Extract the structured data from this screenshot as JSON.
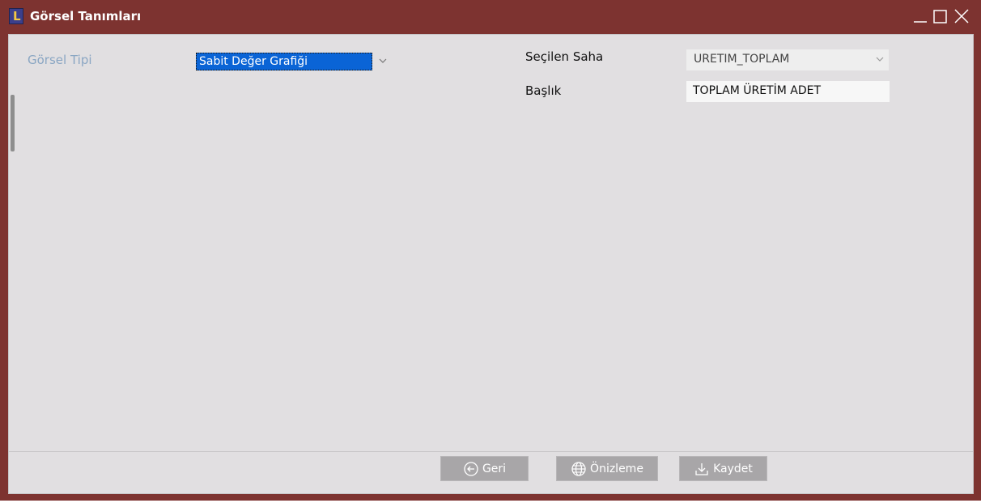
{
  "window": {
    "title": "Görsel Tanımları",
    "app_icon_letter": "L",
    "controls": [
      "minimize-icon",
      "maximize-icon",
      "close-icon"
    ]
  },
  "form": {
    "visual_type_label": "Görsel Tipi",
    "visual_type_value": "Sabit Değer Grafiği",
    "selected_field_label": "Seçilen Saha",
    "selected_field_value": "URETIM_TOPLAM",
    "title_label": "Başlık",
    "title_value": "TOPLAM ÜRETİM ADET"
  },
  "buttons": {
    "back_label": "Geri",
    "preview_label": "Önizleme",
    "save_label": "Kaydet",
    "back_icon": "arrow-left-circle-icon",
    "preview_icon": "globe-icon",
    "save_icon": "download-icon"
  },
  "colors": {
    "frame": "#7d3330",
    "panel": "#e1dfe1",
    "selection": "#0a64d6",
    "disabled_button": "#a8a6a8"
  }
}
